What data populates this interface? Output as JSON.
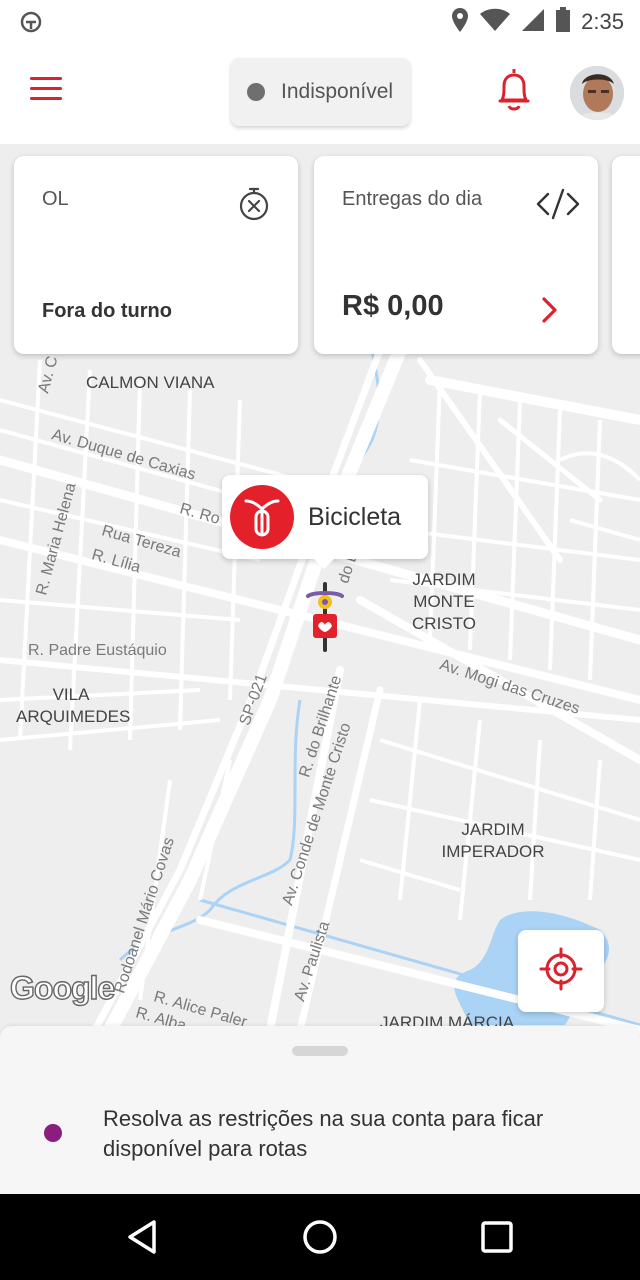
{
  "status_bar": {
    "time": "2:35",
    "icons": [
      "app-notification-icon",
      "location-icon",
      "wifi-icon",
      "signal-icon",
      "battery-icon"
    ]
  },
  "header": {
    "menu_icon": "hamburger-menu-icon",
    "availability": "Indisponível",
    "bell_icon": "bell-icon",
    "avatar": "user-avatar"
  },
  "cards": [
    {
      "title": "OL",
      "value": "Fora do turno",
      "icon": "stopwatch-off-icon"
    },
    {
      "title": "Entregas do dia",
      "value": "R$ 0,00",
      "icon": "hidden-value-icon",
      "action_icon": "chevron-right-icon"
    }
  ],
  "map": {
    "areas": [
      {
        "name": "CALMON VIANA"
      },
      {
        "name": "JARDIM\nMONTE CRISTO"
      },
      {
        "name": "VILA\nARQUIMEDES"
      },
      {
        "name": "JARDIM\nIMPERADOR"
      },
      {
        "name": "JARDIM MÁRCIA"
      }
    ],
    "streets": [
      "Av. Duque de Caxias",
      "R. Ro",
      "Rua Tereza",
      "R. Lília",
      "R. Maria Helena",
      "R. Padre Eustáquio",
      "SP-021",
      "R. do Brilhante",
      "Av. Conde de Monte Cristo",
      "Av. Mogi das Cruzes",
      "Rodoanel Mário Covas",
      "Av. Paulista",
      "R. Alice Paler",
      "R. Alba",
      "do D",
      "Av. C"
    ],
    "google_logo": "Google"
  },
  "vehicle": {
    "label": "Bicicleta",
    "icon": "bicycle-icon"
  },
  "locate_button_icon": "crosshair-icon",
  "bottom_sheet": {
    "message": "Resolva as restrições na sua conta para ficar disponível para rotas"
  },
  "colors": {
    "brand_red": "#e4202b",
    "status_dot": "#6f6f6f",
    "restriction_dot": "#8a1d7e",
    "map_bg": "#eeeeee",
    "water": "#aad3f5"
  }
}
